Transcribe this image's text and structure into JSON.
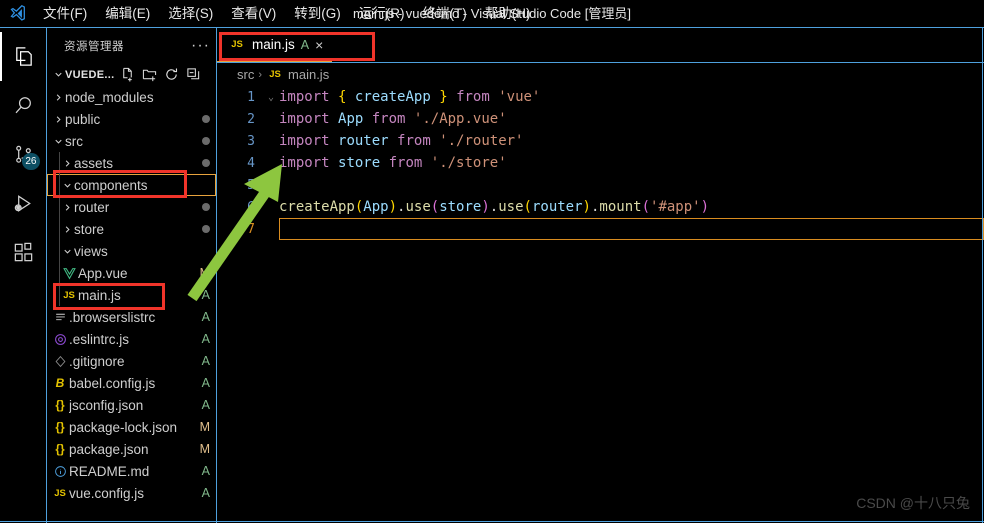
{
  "window": {
    "title": "main.js - vuedemo - Visual Studio Code [管理员]",
    "logo_icon": "vscode-logo-icon"
  },
  "menu": {
    "items": [
      {
        "label": "文件(F)",
        "name": "menu-file"
      },
      {
        "label": "编辑(E)",
        "name": "menu-edit"
      },
      {
        "label": "选择(S)",
        "name": "menu-selection"
      },
      {
        "label": "查看(V)",
        "name": "menu-view"
      },
      {
        "label": "转到(G)",
        "name": "menu-go"
      },
      {
        "label": "运行(R)",
        "name": "menu-run"
      },
      {
        "label": "终端(T)",
        "name": "menu-terminal"
      },
      {
        "label": "帮助(H)",
        "name": "menu-help"
      }
    ]
  },
  "activitybar": {
    "items": [
      {
        "icon": "explorer-icon",
        "active": true,
        "badge": ""
      },
      {
        "icon": "search-icon",
        "active": false,
        "badge": ""
      },
      {
        "icon": "source-control-icon",
        "active": false,
        "badge": "26"
      },
      {
        "icon": "run-and-debug-icon",
        "active": false,
        "badge": ""
      },
      {
        "icon": "extensions-icon",
        "active": false,
        "badge": ""
      }
    ],
    "source_control_badge": "26"
  },
  "sidebar": {
    "title": "资源管理器",
    "more_actions": "···",
    "root": {
      "label": "VUEDE...",
      "actions": [
        "new-file-icon",
        "new-folder-icon",
        "refresh-icon",
        "collapse-all-icon"
      ]
    },
    "tree": [
      {
        "label": "node_modules",
        "type": "folder",
        "expanded": false,
        "depth": 1,
        "status": ""
      },
      {
        "label": "public",
        "type": "folder",
        "expanded": false,
        "depth": 1,
        "status": "dot"
      },
      {
        "label": "src",
        "type": "folder",
        "expanded": true,
        "depth": 1,
        "status": "dot"
      },
      {
        "label": "assets",
        "type": "folder",
        "expanded": false,
        "depth": 2,
        "status": "dot"
      },
      {
        "label": "components",
        "type": "folder",
        "expanded": true,
        "depth": 2,
        "status": "",
        "focused": true
      },
      {
        "label": "router",
        "type": "folder",
        "expanded": false,
        "depth": 2,
        "status": "dot"
      },
      {
        "label": "store",
        "type": "folder",
        "expanded": false,
        "depth": 2,
        "status": "dot"
      },
      {
        "label": "views",
        "type": "folder",
        "expanded": true,
        "depth": 2,
        "status": ""
      },
      {
        "label": "App.vue",
        "type": "file",
        "icon": "vue-file-icon",
        "depth": 2,
        "status": "M"
      },
      {
        "label": "main.js",
        "type": "file",
        "icon": "js-file-icon",
        "depth": 2,
        "status": "A"
      },
      {
        "label": ".browserslistrc",
        "type": "file",
        "icon": "list-file-icon",
        "depth": 1,
        "status": "A"
      },
      {
        "label": ".eslintrc.js",
        "type": "file",
        "icon": "eslint-file-icon",
        "depth": 1,
        "status": "A"
      },
      {
        "label": ".gitignore",
        "type": "file",
        "icon": "git-file-icon",
        "depth": 1,
        "status": "A"
      },
      {
        "label": "babel.config.js",
        "type": "file",
        "icon": "babel-file-icon",
        "depth": 1,
        "status": "A"
      },
      {
        "label": "jsconfig.json",
        "type": "file",
        "icon": "json-file-icon",
        "depth": 1,
        "status": "A"
      },
      {
        "label": "package-lock.json",
        "type": "file",
        "icon": "json-file-icon",
        "depth": 1,
        "status": "M"
      },
      {
        "label": "package.json",
        "type": "file",
        "icon": "json-file-icon",
        "depth": 1,
        "status": "M"
      },
      {
        "label": "README.md",
        "type": "file",
        "icon": "md-file-icon",
        "depth": 1,
        "status": "A"
      },
      {
        "label": "vue.config.js",
        "type": "file",
        "icon": "js-file-icon",
        "depth": 1,
        "status": "A"
      }
    ]
  },
  "editor": {
    "tabs": [
      {
        "label": "main.js",
        "icon": "js-file-icon",
        "status": "A",
        "close": "×",
        "active": true
      }
    ],
    "breadcrumb": [
      {
        "label": "src",
        "icon": ""
      },
      {
        "label": "main.js",
        "icon": "js-file-icon"
      }
    ],
    "breadcrumb_separator": "›",
    "current_line": 7,
    "lines": [
      {
        "n": "1",
        "fold": "⌄",
        "tokens": [
          {
            "t": "import",
            "c": "t-key"
          },
          {
            "t": " ",
            "c": "t-plain"
          },
          {
            "t": "{",
            "c": "t-brace"
          },
          {
            "t": " ",
            "c": "t-plain"
          },
          {
            "t": "createApp",
            "c": "t-ident"
          },
          {
            "t": " ",
            "c": "t-plain"
          },
          {
            "t": "}",
            "c": "t-brace"
          },
          {
            "t": " ",
            "c": "t-plain"
          },
          {
            "t": "from",
            "c": "t-key"
          },
          {
            "t": " ",
            "c": "t-plain"
          },
          {
            "t": "'vue'",
            "c": "t-str"
          }
        ]
      },
      {
        "n": "2",
        "fold": "",
        "tokens": [
          {
            "t": "import",
            "c": "t-key"
          },
          {
            "t": " ",
            "c": "t-plain"
          },
          {
            "t": "App",
            "c": "t-ident"
          },
          {
            "t": " ",
            "c": "t-plain"
          },
          {
            "t": "from",
            "c": "t-key"
          },
          {
            "t": " ",
            "c": "t-plain"
          },
          {
            "t": "'./App.vue'",
            "c": "t-str"
          }
        ]
      },
      {
        "n": "3",
        "fold": "",
        "tokens": [
          {
            "t": "import",
            "c": "t-key"
          },
          {
            "t": " ",
            "c": "t-plain"
          },
          {
            "t": "router",
            "c": "t-ident"
          },
          {
            "t": " ",
            "c": "t-plain"
          },
          {
            "t": "from",
            "c": "t-key"
          },
          {
            "t": " ",
            "c": "t-plain"
          },
          {
            "t": "'./router'",
            "c": "t-str"
          }
        ]
      },
      {
        "n": "4",
        "fold": "",
        "tokens": [
          {
            "t": "import",
            "c": "t-key"
          },
          {
            "t": " ",
            "c": "t-plain"
          },
          {
            "t": "store",
            "c": "t-ident"
          },
          {
            "t": " ",
            "c": "t-plain"
          },
          {
            "t": "from",
            "c": "t-key"
          },
          {
            "t": " ",
            "c": "t-plain"
          },
          {
            "t": "'./store'",
            "c": "t-str"
          }
        ]
      },
      {
        "n": "5",
        "fold": "",
        "tokens": []
      },
      {
        "n": "6",
        "fold": "",
        "tokens": [
          {
            "t": "createApp",
            "c": "t-fn"
          },
          {
            "t": "(",
            "c": "t-par"
          },
          {
            "t": "App",
            "c": "t-ident"
          },
          {
            "t": ")",
            "c": "t-par"
          },
          {
            "t": ".",
            "c": "t-plain"
          },
          {
            "t": "use",
            "c": "t-fn"
          },
          {
            "t": "(",
            "c": "t-par2"
          },
          {
            "t": "store",
            "c": "t-ident"
          },
          {
            "t": ")",
            "c": "t-par2"
          },
          {
            "t": ".",
            "c": "t-plain"
          },
          {
            "t": "use",
            "c": "t-fn"
          },
          {
            "t": "(",
            "c": "t-par"
          },
          {
            "t": "router",
            "c": "t-ident"
          },
          {
            "t": ")",
            "c": "t-par"
          },
          {
            "t": ".",
            "c": "t-plain"
          },
          {
            "t": "mount",
            "c": "t-fn"
          },
          {
            "t": "(",
            "c": "t-par2"
          },
          {
            "t": "'#app'",
            "c": "t-str"
          },
          {
            "t": ")",
            "c": "t-par2"
          }
        ]
      },
      {
        "n": "7",
        "fold": "",
        "tokens": [],
        "current": true
      }
    ]
  },
  "annotations": {
    "rect_tab": "highlight-tab-main-js",
    "rect_components": "highlight-tree-components",
    "rect_mainjs": "highlight-tree-main-js",
    "arrow": "green-arrow-annotation"
  },
  "watermark": {
    "text": "CSDN @十八只兔"
  }
}
